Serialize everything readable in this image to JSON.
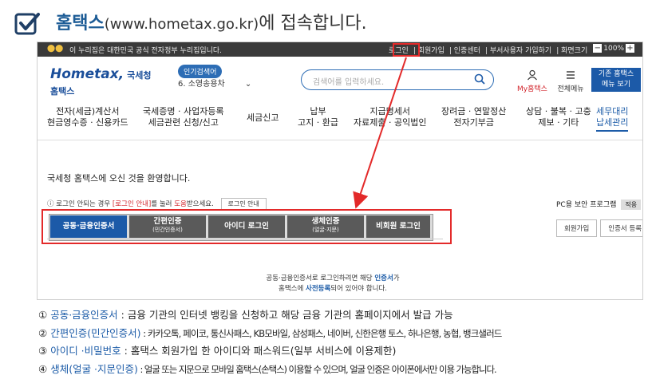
{
  "slide": {
    "title_main": "홈택스",
    "title_url": "(www.hometax.go.kr)",
    "title_rest": "에 접속합니다."
  },
  "gov_banner": {
    "logo": "⬤⬤",
    "text": "이 누리집은 대한민국 공식 전자정부 누리집입니다.",
    "links": [
      "로그인",
      "회원가입",
      "인증센터",
      "부서사용자 가입하기",
      "화면크기"
    ],
    "zoom_minus": "−",
    "zoom_value": "100%",
    "zoom_plus": "+"
  },
  "header": {
    "logo_main": "Hometax,",
    "logo_sub": "국세청홈택스",
    "popular_badge": "인기검색어",
    "popular_item": "6.  소영송용차",
    "search_placeholder": "검색어를 입력하세요.",
    "my_hometax": "My홈택스",
    "all_menu": "전체메뉴",
    "old_hometax_line1": "기존 홈택스",
    "old_hometax_line2": "메뉴 보기"
  },
  "nav": [
    {
      "l1": "전자(세금)계산서",
      "l2": "현금영수증 · 신용카드"
    },
    {
      "l1": "국세증명 · 사업자등록",
      "l2": "세금관련 신청/신고"
    },
    {
      "l1": "세금신고",
      "l2": ""
    },
    {
      "l1": "납부",
      "l2": "고지 · 환급"
    },
    {
      "l1": "지급명세서",
      "l2": "자료제출 · 공익법인"
    },
    {
      "l1": "장려금 · 연말정산",
      "l2": "전자기부금"
    },
    {
      "l1": "상담 · 불복 · 고충",
      "l2": "제보 · 기타"
    },
    {
      "l1": "세무대리",
      "l2": "납세관리"
    }
  ],
  "login": {
    "welcome": "국세청 홈택스에 오신 것을 환영합니다.",
    "help_pre": "로그인 안되는 경우 ",
    "help_link": "[로그인 안내]",
    "help_mid": "를 눌러 ",
    "help_red": "도움",
    "help_post": "받으세요.",
    "help_button": "로그인 안내",
    "pc_security": "PC용 보안 프로그램",
    "pc_button": "적용",
    "tabs": [
      {
        "label": "공동·금융인증서",
        "sub": ""
      },
      {
        "label": "간편인증",
        "sub": "(민간인증서)"
      },
      {
        "label": "아이디 로그인",
        "sub": ""
      },
      {
        "label": "생체인증",
        "sub": "(얼굴·지문)"
      },
      {
        "label": "비회원 로그인",
        "sub": ""
      }
    ],
    "signup_button": "회원가입",
    "cert_register_button": "인증서 등록",
    "cert_msg_1": "공동·금융인증서로 로그인하려면 해당 ",
    "cert_msg_1_blue": "인증서",
    "cert_msg_1_end": "가",
    "cert_msg_2": "홈택스에 ",
    "cert_msg_2_blue": "사전등록",
    "cert_msg_2_end": "되어 있어야 합니다."
  },
  "descriptions": [
    {
      "num": "①",
      "term": "공동·금융인증서",
      "text": " : 금융 기관의 인터넷 뱅킹을 신청하고 해당 금융 기관의 홈페이지에서 발급 가능"
    },
    {
      "num": "②",
      "term": "간편인증(민간인증서)",
      "text": " : 카카오톡, 페이코, 통신사패스, KB모바일, 삼성패스, 네이버, 신한은행 토스, 하나은행, 농협, 뱅크샐러드"
    },
    {
      "num": "③",
      "term": "아이디 ·비밀번호",
      "text": " : 홈택스 회원가입 한 아이디와 패스워드(일부 서비스에 이용제한)"
    },
    {
      "num": "④",
      "term": "생체(얼굴 ·지문인증)",
      "text": " : 얼굴 또는 지문으로 모바일 홈택스(손택스) 이용할 수 있으며, 얼굴 인증은 아이폰에서만 이용 가능합니다."
    }
  ],
  "colors": {
    "accent_blue": "#1c5aa8",
    "annotation_red": "#e32a2a",
    "tab_gray": "#5a5a5a"
  }
}
